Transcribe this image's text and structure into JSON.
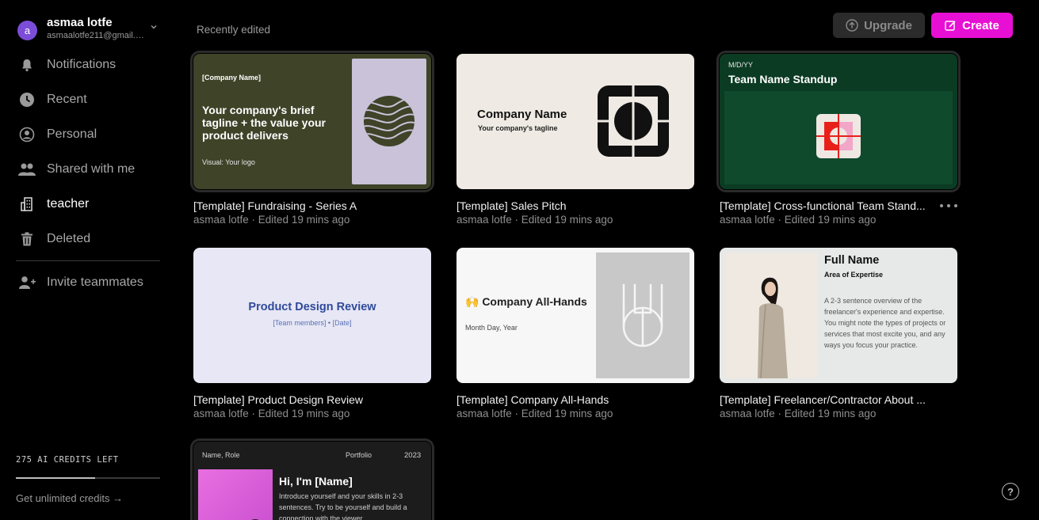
{
  "account": {
    "avatar_letter": "a",
    "name": "asmaa lotfe",
    "email": "asmaalotfe211@gmail.c..."
  },
  "nav": {
    "notifications": "Notifications",
    "recent": "Recent",
    "personal": "Personal",
    "shared": "Shared with me",
    "teacher": "teacher",
    "deleted": "Deleted",
    "invite": "Invite teammates"
  },
  "credits": {
    "label": "275 AI CREDITS LEFT",
    "fraction_remaining": 0.55,
    "unlimited_link": "Get unlimited credits"
  },
  "header": {
    "section_title": "Recently edited",
    "upgrade_label": "Upgrade",
    "create_label": "Create"
  },
  "cards": [
    {
      "title": "[Template] Fundraising - Series A",
      "meta": "asmaa lotfe · Edited 19 mins ago",
      "thumb": {
        "company": "[Company Name]",
        "tagline": "Your company's brief tagline + the value your product delivers",
        "visual": "Visual: Your logo"
      }
    },
    {
      "title": "[Template] Sales Pitch",
      "meta": "asmaa lotfe · Edited 19 mins ago",
      "thumb": {
        "company": "Company Name",
        "tagline": "Your company's tagline"
      }
    },
    {
      "title": "[Template] Cross-functional Team Stand...",
      "meta": "asmaa lotfe · Edited 19 mins ago",
      "thumb": {
        "date": "M/D/YY",
        "title": "Team Name Standup"
      }
    },
    {
      "title": "[Template] Product Design Review",
      "meta": "asmaa lotfe · Edited 19 mins ago",
      "thumb": {
        "title": "Product Design Review",
        "subtitle": "[Team members] • [Date]"
      }
    },
    {
      "title": "[Template] Company All-Hands",
      "meta": "asmaa lotfe · Edited 19 mins ago",
      "thumb": {
        "title": "🙌 Company All-Hands",
        "date": "Month Day, Year"
      }
    },
    {
      "title": "[Template] Freelancer/Contractor About ...",
      "meta": "asmaa lotfe · Edited 19 mins ago",
      "thumb": {
        "name": "Full Name",
        "expertise": "Area of Expertise",
        "bio": "A 2-3 sentence overview of the freelancer's experience and expertise. You might note the types of projects or services that most excite you, and any ways you focus your practice."
      }
    },
    {
      "thumb": {
        "name_role": "Name, Role",
        "portfolio": "Portfolio",
        "year": "2023",
        "greeting": "Hi, I'm [Name]",
        "intro": "Introduce yourself and your skills in 2-3 sentences. Try to be yourself and build a connection with the viewer."
      }
    }
  ],
  "help_label": "?",
  "colors": {
    "accent": "#e80fd4",
    "avatar": "#7c4dd8"
  }
}
